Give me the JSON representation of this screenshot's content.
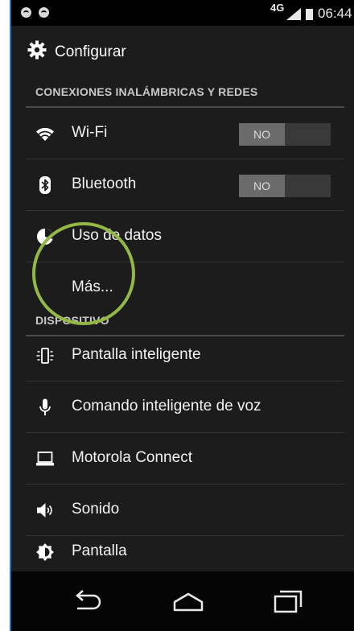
{
  "status_bar": {
    "network": "4G",
    "time": "06:44"
  },
  "header": {
    "title": "Configurar"
  },
  "sections": [
    {
      "title": "CONEXIONES INALÁMBRICAS Y REDES",
      "items": [
        {
          "label": "Wi-Fi",
          "icon": "wifi-icon",
          "toggle": "NO"
        },
        {
          "label": "Bluetooth",
          "icon": "bluetooth-icon",
          "toggle": "NO"
        },
        {
          "label": "Uso de datos",
          "icon": "data-usage-icon"
        },
        {
          "label": "Más...",
          "icon": ""
        }
      ]
    },
    {
      "title": "DISPOSITIVO",
      "items": [
        {
          "label": "Pantalla inteligente",
          "icon": "smart-display-icon"
        },
        {
          "label": "Comando inteligente de voz",
          "icon": "microphone-icon"
        },
        {
          "label": "Motorola Connect",
          "icon": "laptop-icon"
        },
        {
          "label": "Sonido",
          "icon": "speaker-icon"
        },
        {
          "label": "Pantalla",
          "icon": "brightness-icon"
        }
      ]
    }
  ],
  "navigation": [
    "back-icon",
    "home-icon",
    "recents-icon"
  ],
  "colors": {
    "background": "#1c1c1c",
    "highlight_circle": "#93b845",
    "toggle_off": "#6b6b6b"
  }
}
